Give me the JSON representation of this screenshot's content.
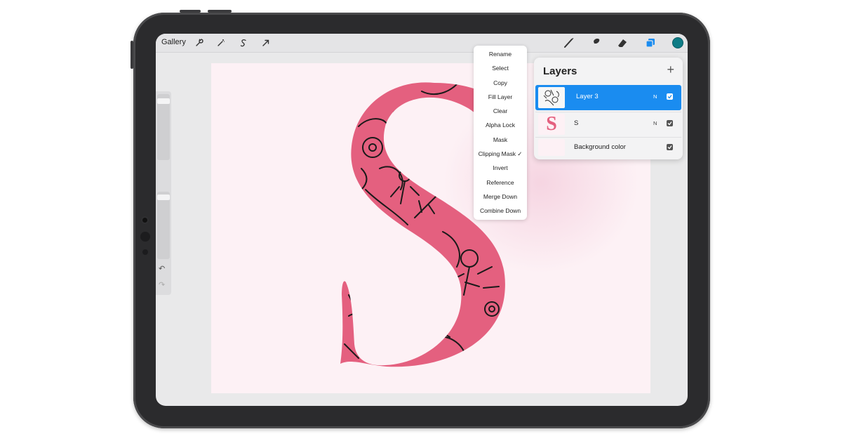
{
  "toolbar": {
    "gallery_label": "Gallery",
    "accent_color": "#0e7c86"
  },
  "layer_menu": {
    "items": [
      "Rename",
      "Select",
      "Copy",
      "Fill Layer",
      "Clear",
      "Alpha Lock",
      "Mask",
      "Clipping Mask ✓",
      "Invert",
      "Reference",
      "Merge Down",
      "Combine Down"
    ]
  },
  "layers_panel": {
    "title": "Layers",
    "add_symbol": "+",
    "layers": [
      {
        "name": "Layer 3",
        "blend": "N",
        "selected": true
      },
      {
        "name": "S",
        "blend": "N",
        "selected": false
      },
      {
        "name": "Background color",
        "blend": "",
        "selected": false
      }
    ],
    "thumb_letter": "S"
  },
  "sidebar": {
    "undo_symbol": "↶",
    "redo_symbol": "↷"
  },
  "colors": {
    "letter_fill": "#e4607f",
    "canvas_bg": "#fdf1f5",
    "selection_blue": "#1a8cf0"
  }
}
